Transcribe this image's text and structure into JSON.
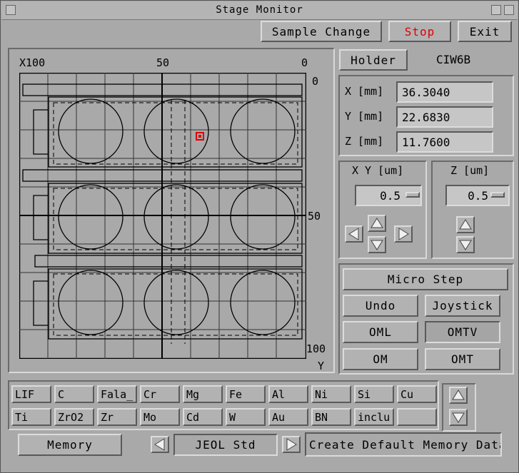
{
  "window": {
    "title": "Stage Monitor"
  },
  "toolbar": {
    "sample_change": "Sample Change",
    "stop": "Stop",
    "exit": "Exit"
  },
  "map": {
    "x_left": "X100",
    "x_mid": "50",
    "x_right": "0",
    "y_top": "0",
    "y_mid": "50",
    "y_bottom": "100",
    "y_axis": "Y"
  },
  "holder": {
    "label": "Holder",
    "value": "CIW6B"
  },
  "coords": {
    "x_label": "X [mm]",
    "x_value": "36.3040",
    "y_label": "Y [mm]",
    "y_value": "22.6830",
    "z_label": "Z [mm]",
    "z_value": "11.7600"
  },
  "xy_step": {
    "label": "X Y [um]",
    "value": "0.5"
  },
  "z_step": {
    "label": "Z [um]",
    "value": "0.5"
  },
  "micro": {
    "micro_step": "Micro  Step",
    "undo": "Undo",
    "joystick": "Joystick",
    "oml": "OML",
    "omtv": "OMTV",
    "om": "OM",
    "omt": "OMT"
  },
  "materials": {
    "row1": [
      "LIF",
      "C",
      "Fala_",
      "Cr",
      "Mg",
      "Fe",
      "Al",
      "Ni",
      "Si",
      "Cu"
    ],
    "row2": [
      "Ti",
      "ZrO2",
      "Zr",
      "Mo",
      "Cd",
      "W",
      "Au",
      "BN",
      "inclu",
      ""
    ]
  },
  "memory": {
    "button": "Memory",
    "standard": "JEOL Std",
    "create": "Create Default Memory Data"
  },
  "colors": {
    "stop_text": "#e00000",
    "marker": "#e00000",
    "background": "#a9a9a9"
  }
}
